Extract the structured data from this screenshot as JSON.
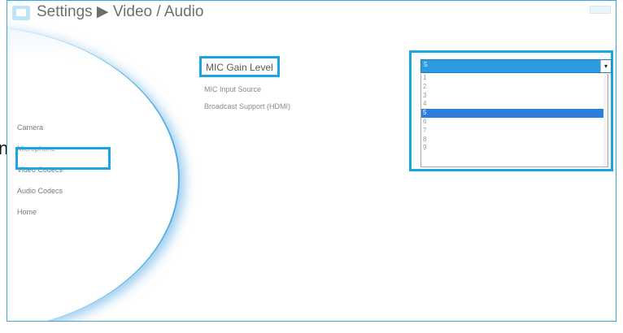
{
  "header": {
    "title": "Settings ▶ Video / Audio",
    "app_icon": "monitor-icon"
  },
  "sidebar": {
    "items": [
      {
        "label": "Camera",
        "active": false
      },
      {
        "label": "Microphone",
        "active": true
      },
      {
        "label": "Video Codecs",
        "active": false
      },
      {
        "label": "Audio Codecs",
        "active": false
      },
      {
        "label": "Home",
        "active": false
      }
    ]
  },
  "main": {
    "section_title": "MIC Gain Level",
    "items": [
      "MIC Input Source",
      "Broadcast Support (HDMI)"
    ]
  },
  "gain_select": {
    "selected": "5",
    "options": [
      "1",
      "2",
      "3",
      "4",
      "5",
      "6",
      "7",
      "8",
      "9"
    ]
  },
  "edge_char": "n",
  "colors": {
    "highlight": "#1ba6e3",
    "selected_option": "#2d7fdd",
    "select_bar": "#2d9be0"
  }
}
